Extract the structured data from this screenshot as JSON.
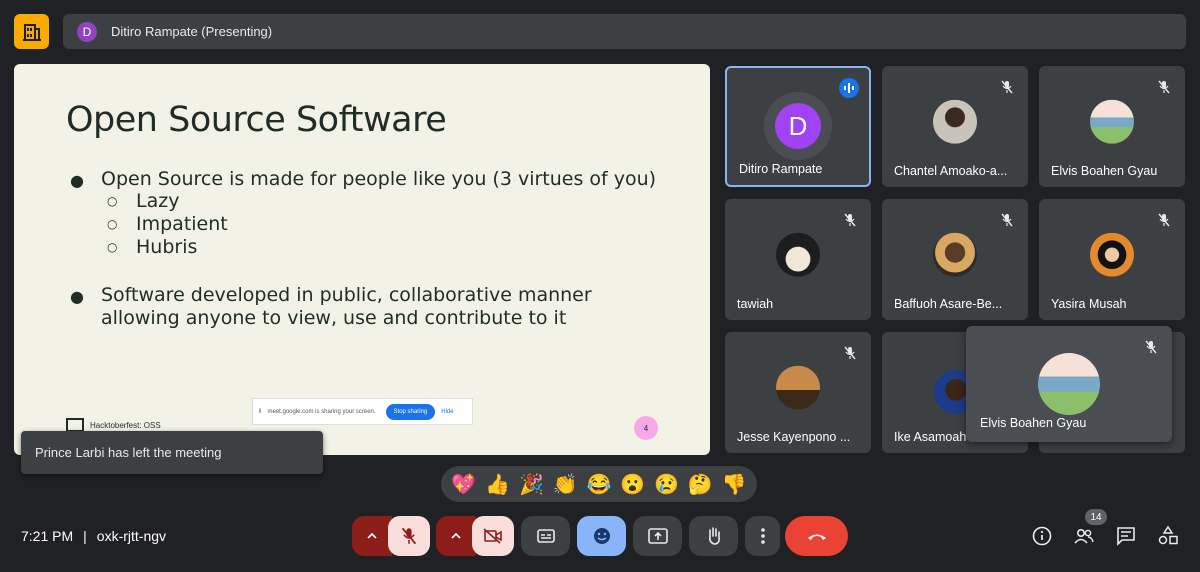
{
  "presenter": {
    "initial": "D",
    "label": "Ditiro Rampate (Presenting)"
  },
  "slide": {
    "title": "Open Source Software",
    "bullet1": "Open Source is made for people like you (3 virtues of you)",
    "sub1": "Lazy",
    "sub2": "Impatient",
    "sub3": "Hubris",
    "bullet2_line1": "Software developed in public, collaborative manner",
    "bullet2_line2": "allowing anyone to view, use and contribute to it",
    "footer": "Hacktoberfest: OSS",
    "page_number": "4",
    "share_banner": {
      "text": "meet.google.com is sharing your screen.",
      "stop_label": "Stop sharing",
      "hide_label": "Hide"
    }
  },
  "toast": "Prince Larbi has left the meeting",
  "participants": [
    {
      "name": "Ditiro Rampate",
      "initial": "D",
      "speaking": true
    },
    {
      "name": "Chantel Amoako-a...",
      "muted": true
    },
    {
      "name": "Elvis Boahen Gyau",
      "muted": true
    },
    {
      "name": "tawiah",
      "muted": true
    },
    {
      "name": "Baffuoh Asare-Be...",
      "muted": true
    },
    {
      "name": "Yasira Musah",
      "muted": true
    },
    {
      "name": "Jesse Kayenpono ...",
      "muted": true
    },
    {
      "name": "Ike Asamoah",
      "muted": true
    },
    {
      "name": "Elvis Boahen Gyau",
      "muted": true,
      "popup": true
    }
  ],
  "reactions": [
    "sparkling-heart",
    "thumbs-up",
    "party-popper",
    "clapping-hands",
    "joy",
    "surprised",
    "crying",
    "thinking",
    "thumbs-down"
  ],
  "meeting": {
    "time": "7:21 PM",
    "separator": "|",
    "code": "oxk-rjtt-ngv"
  },
  "people_count": "14",
  "colors": {
    "accent_blue": "#8ab4f8",
    "end_call_red": "#ea4335",
    "logo_yellow": "#f9ab00",
    "tile_bg": "#3c4043",
    "bg": "#202124"
  }
}
